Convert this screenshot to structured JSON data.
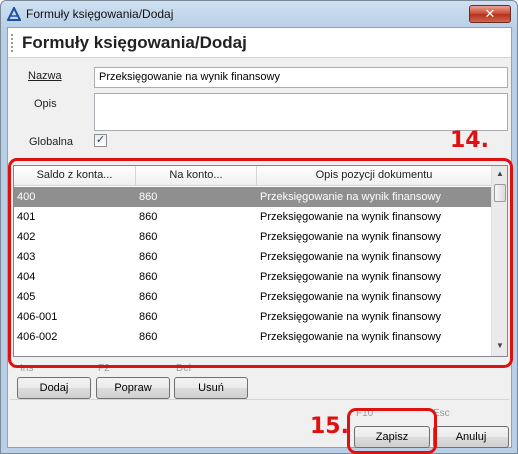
{
  "window": {
    "title": "Formuły księgowania/Dodaj"
  },
  "header": {
    "title": "Formuły księgowania/Dodaj"
  },
  "form": {
    "nazwa_label": "Nazwa",
    "nazwa_value": "Przeksięgowanie na wynik finansowy",
    "opis_label": "Opis",
    "opis_value": "",
    "globalna_label": "Globalna",
    "globalna_checked": true
  },
  "grid": {
    "columns": [
      "Saldo z konta...",
      "Na konto...",
      "Opis pozycji dokumentu"
    ],
    "rows": [
      [
        "400",
        "860",
        "Przeksięgowanie na wynik finansowy"
      ],
      [
        "401",
        "860",
        "Przeksięgowanie na wynik finansowy"
      ],
      [
        "402",
        "860",
        "Przeksięgowanie na wynik finansowy"
      ],
      [
        "403",
        "860",
        "Przeksięgowanie na wynik finansowy"
      ],
      [
        "404",
        "860",
        "Przeksięgowanie na wynik finansowy"
      ],
      [
        "405",
        "860",
        "Przeksięgowanie na wynik finansowy"
      ],
      [
        "406-001",
        "860",
        "Przeksięgowanie na wynik finansowy"
      ],
      [
        "406-002",
        "860",
        "Przeksięgowanie na wynik finansowy"
      ]
    ],
    "selected_row": 0
  },
  "grid_buttons": {
    "add_hint": "Ins",
    "add_label": "Dodaj",
    "edit_hint": "F2",
    "edit_label": "Popraw",
    "delete_hint": "Del",
    "delete_label": "Usuń"
  },
  "footer": {
    "save_hint": "F10",
    "save_label": "Zapisz",
    "cancel_hint": "Esc",
    "cancel_label": "Anuluj"
  },
  "annotations": {
    "grid_number": "14.",
    "save_number": "15.",
    "color": "#e01010"
  },
  "icons": {
    "window": "triangle-logo-icon",
    "close": "close-icon",
    "check": "check-icon"
  }
}
